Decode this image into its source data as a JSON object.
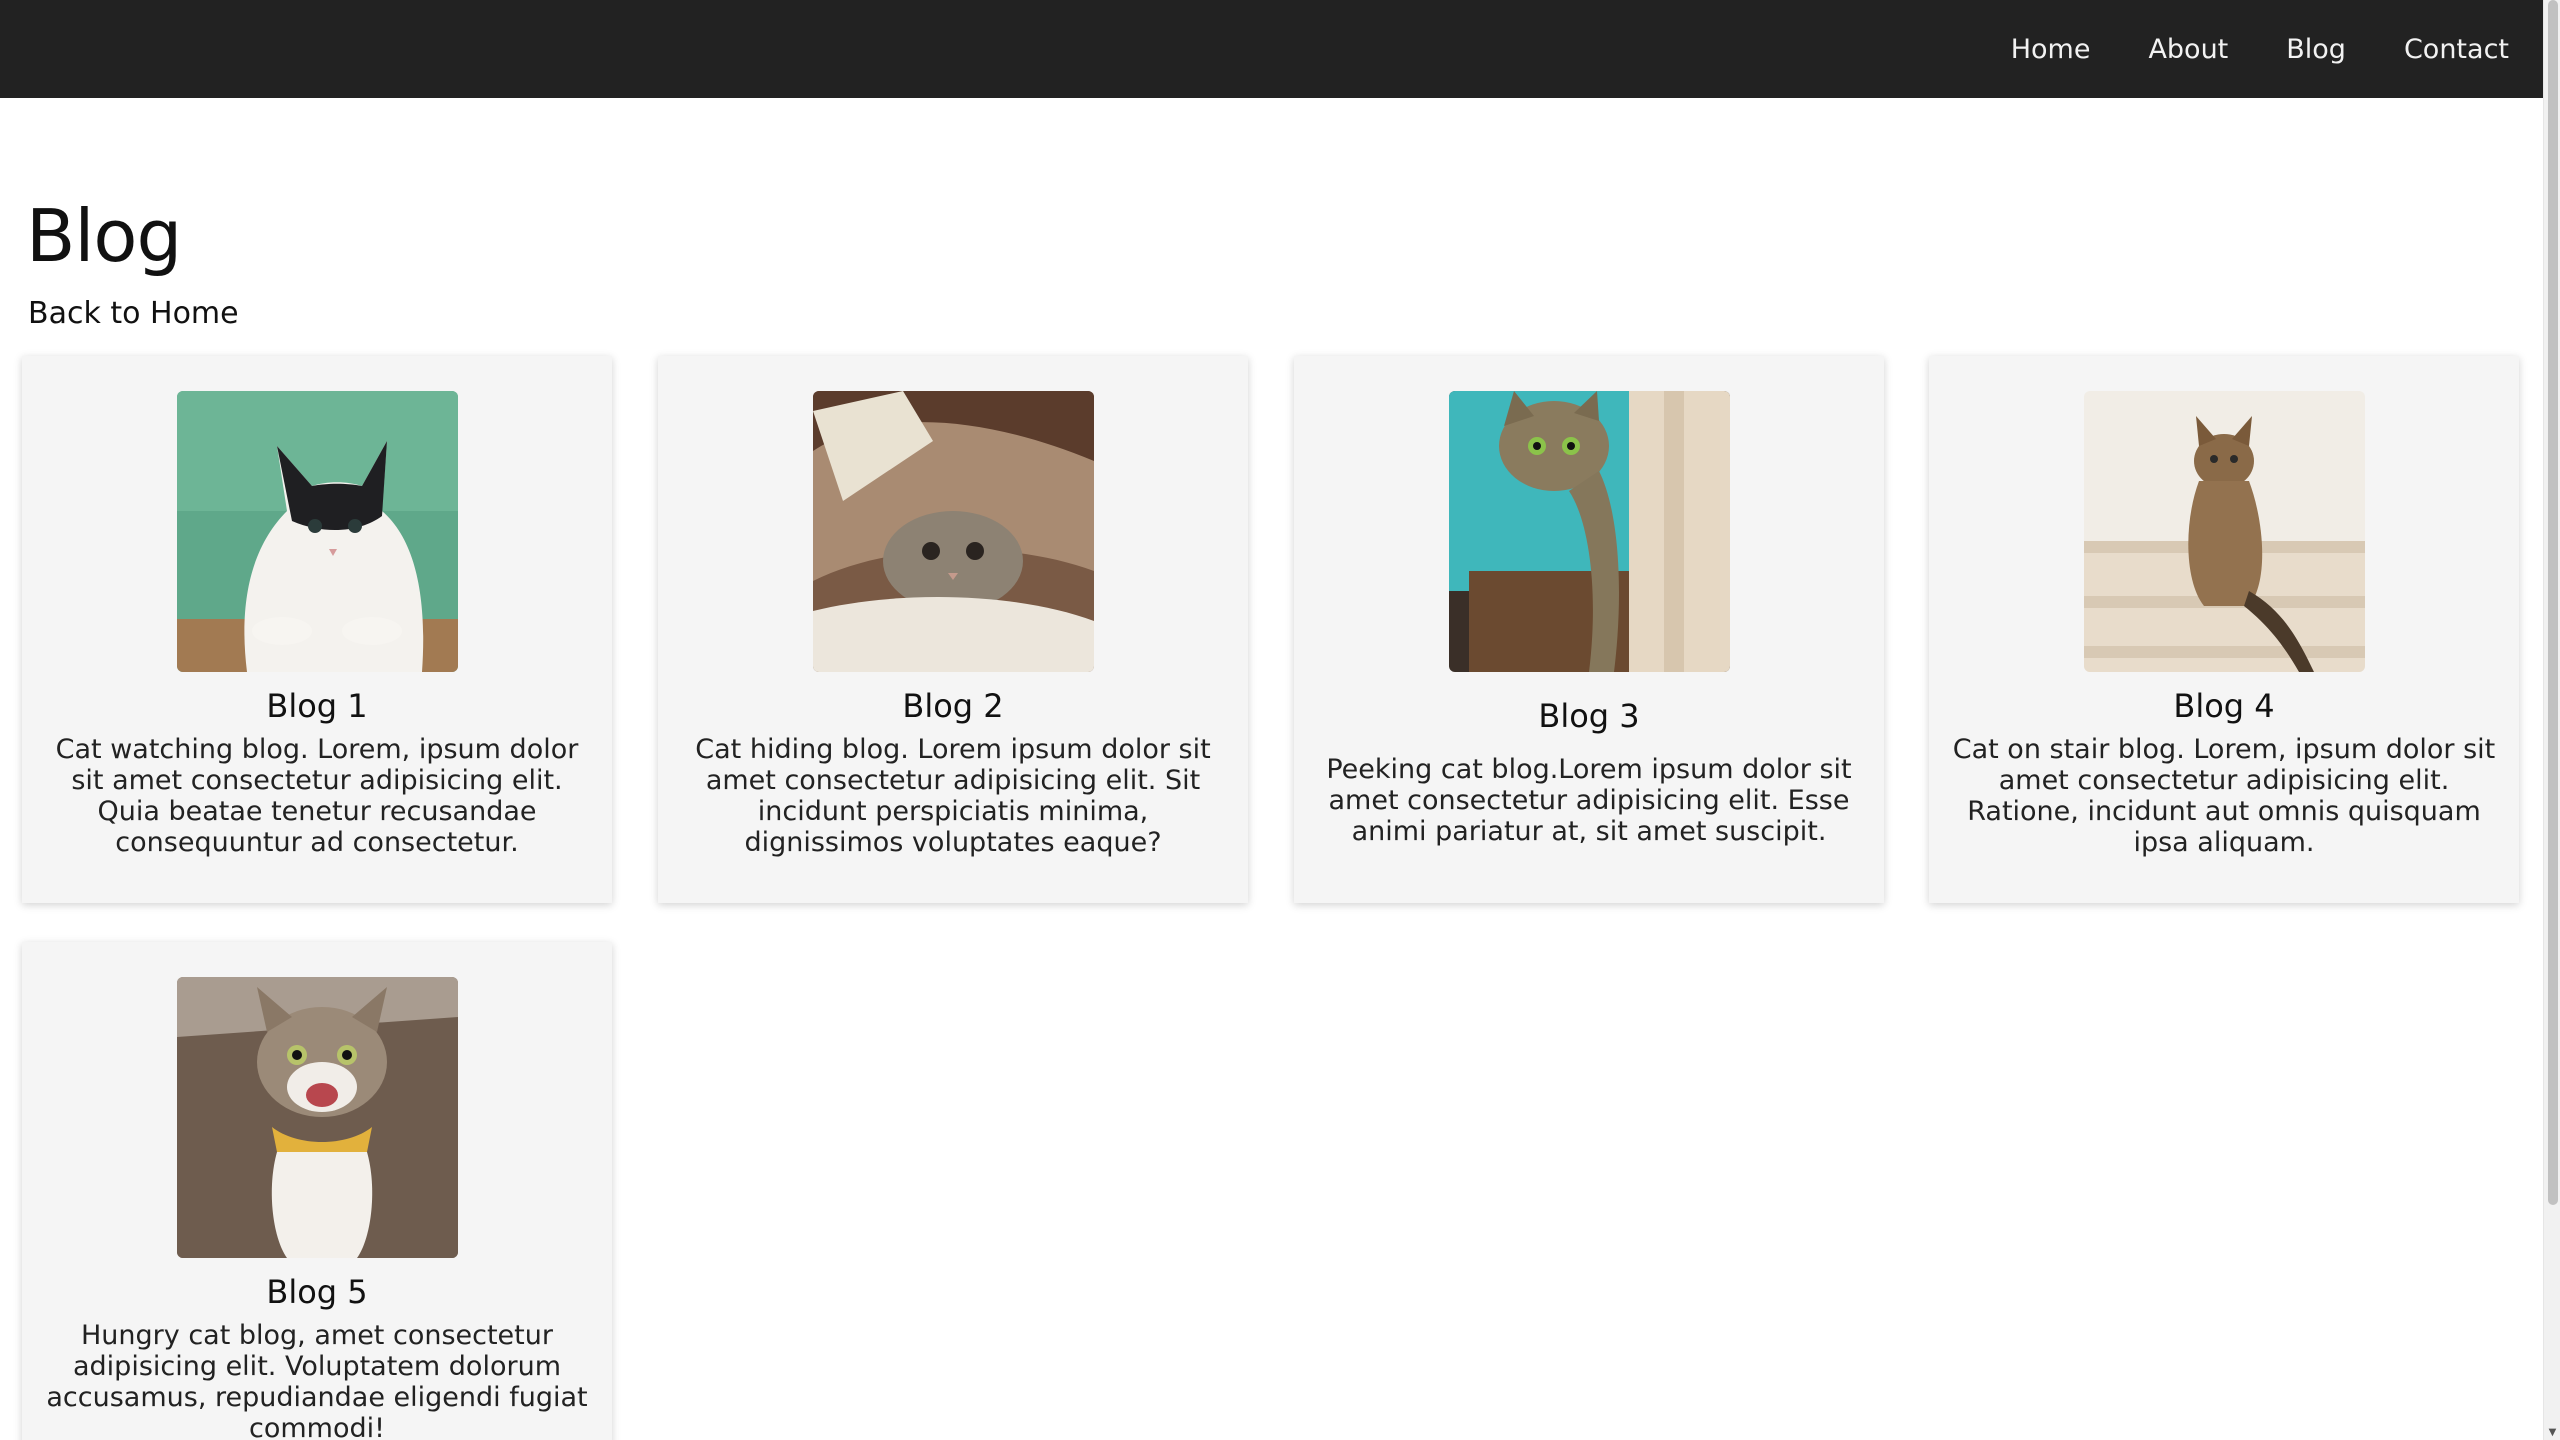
{
  "nav": {
    "links": [
      "Home",
      "About",
      "Blog",
      "Contact"
    ]
  },
  "header": {
    "title": "Blog",
    "back_link": "Back to Home"
  },
  "cards": [
    {
      "title": "Blog 1",
      "text": "Cat watching blog. Lorem, ipsum dolor sit amet consectetur adipisicing elit. Quia beatae tenetur recusandae consequuntur ad consectetur.",
      "image": "cat-on-green-wall-photo"
    },
    {
      "title": "Blog 2",
      "text": "Cat hiding blog. Lorem ipsum dolor sit amet consectetur adipisicing elit. Sit incidunt perspiciatis minima, dignissimos voluptates eaque?",
      "image": "cat-under-blanket-photo"
    },
    {
      "title": "Blog 3",
      "text": "Peeking cat blog.Lorem ipsum dolor sit amet consectetur adipisicing elit. Esse animi pariatur at, sit amet suscipit.",
      "image": "cat-peeking-photo"
    },
    {
      "title": "Blog 4",
      "text": "Cat on stair blog. Lorem, ipsum dolor sit amet consectetur adipisicing elit. Ratione, incidunt aut omnis quisquam ipsa aliquam.",
      "image": "cat-on-stairs-photo"
    },
    {
      "title": "Blog 5",
      "text": "Hungry cat blog, amet consectetur adipisicing elit. Voluptatem dolorum accusamus, repudiandae eligendi fugiat commodi!",
      "image": "cat-meowing-photo"
    }
  ],
  "colors": {
    "navbar_bg": "#222222",
    "card_bg": "#f5f5f5",
    "text": "#111111"
  }
}
